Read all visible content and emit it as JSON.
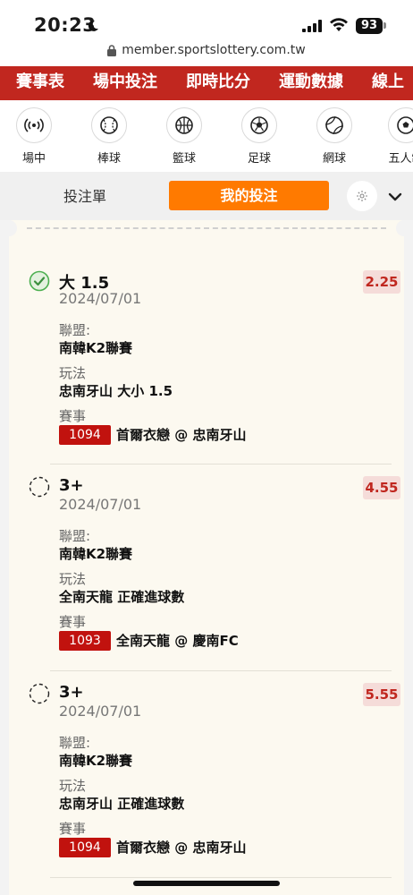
{
  "status_bar": {
    "time": "20:23",
    "battery": "93"
  },
  "browser": {
    "url": "member.sportslottery.com.tw"
  },
  "nav": {
    "items": [
      "賽事表",
      "場中投注",
      "即時比分",
      "運動數據",
      "線上"
    ]
  },
  "sports": [
    {
      "label": "場中",
      "icon": "live-icon"
    },
    {
      "label": "棒球",
      "icon": "baseball-icon"
    },
    {
      "label": "籃球",
      "icon": "basketball-icon"
    },
    {
      "label": "足球",
      "icon": "soccer-icon"
    },
    {
      "label": "網球",
      "icon": "tennis-icon"
    },
    {
      "label": "五人制",
      "icon": "futsal-icon"
    }
  ],
  "slip": {
    "tab_bet_slip": "投注單",
    "tab_my_bets": "我的投注"
  },
  "bets": [
    {
      "selection": "大 1.5",
      "date": "2024/07/01",
      "odds": "2.25",
      "status": "won",
      "league_label": "聯盟:",
      "league": "南韓K2聯賽",
      "market_label": "玩法",
      "market": "忠南牙山 大小 1.5",
      "event_label": "賽事",
      "match_code": "1094",
      "match": "首爾衣戀 @ 忠南牙山"
    },
    {
      "selection": "3+",
      "date": "2024/07/01",
      "odds": "4.55",
      "status": "pending",
      "league_label": "聯盟:",
      "league": "南韓K2聯賽",
      "market_label": "玩法",
      "market": "全南天龍 正確進球數",
      "event_label": "賽事",
      "match_code": "1093",
      "match": "全南天龍 @ 慶南FC"
    },
    {
      "selection": "3+",
      "date": "2024/07/01",
      "odds": "5.55",
      "status": "pending",
      "league_label": "聯盟:",
      "league": "南韓K2聯賽",
      "market_label": "玩法",
      "market": "忠南牙山 正確進球數",
      "event_label": "賽事",
      "match_code": "1094",
      "match": "首爾衣戀 @ 忠南牙山"
    }
  ],
  "colors": {
    "brand_red": "#c1271f",
    "accent_orange": "#ff7a00",
    "odds_red": "#c0271f",
    "won_green": "#4caf50"
  }
}
